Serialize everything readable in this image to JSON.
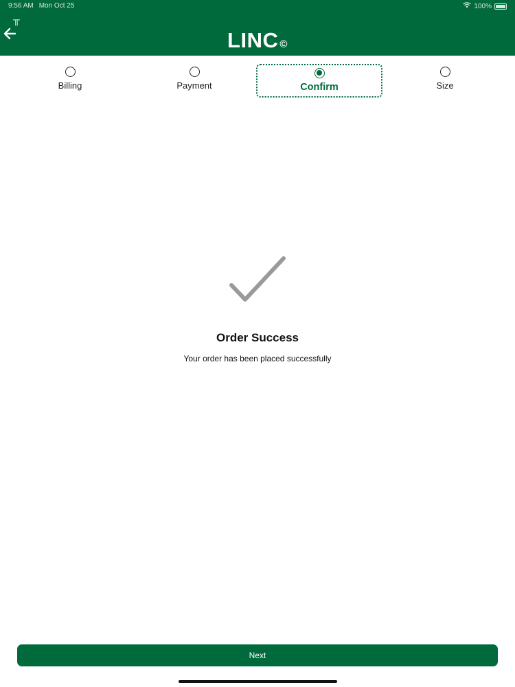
{
  "status_bar": {
    "time": "9:56 AM",
    "date": "Mon Oct 25",
    "battery": "100%",
    "wifi_icon": "wifi-icon",
    "battery_icon": "battery-icon"
  },
  "header": {
    "title": "LINC",
    "mark": "©",
    "back_icon": "arrow-left-icon",
    "background": "#006a3d"
  },
  "steps": [
    {
      "label": "Billing",
      "selected": false
    },
    {
      "label": "Payment",
      "selected": false
    },
    {
      "label": "Confirm",
      "selected": true
    },
    {
      "label": "Size",
      "selected": false
    }
  ],
  "success": {
    "icon": "checkmark-icon",
    "title": "Order Success",
    "message": "Your order has been placed successfully"
  },
  "footer": {
    "next_label": "Next"
  },
  "colors": {
    "brand": "#006a3d",
    "check": "#9a9a9a",
    "text": "#111111"
  }
}
